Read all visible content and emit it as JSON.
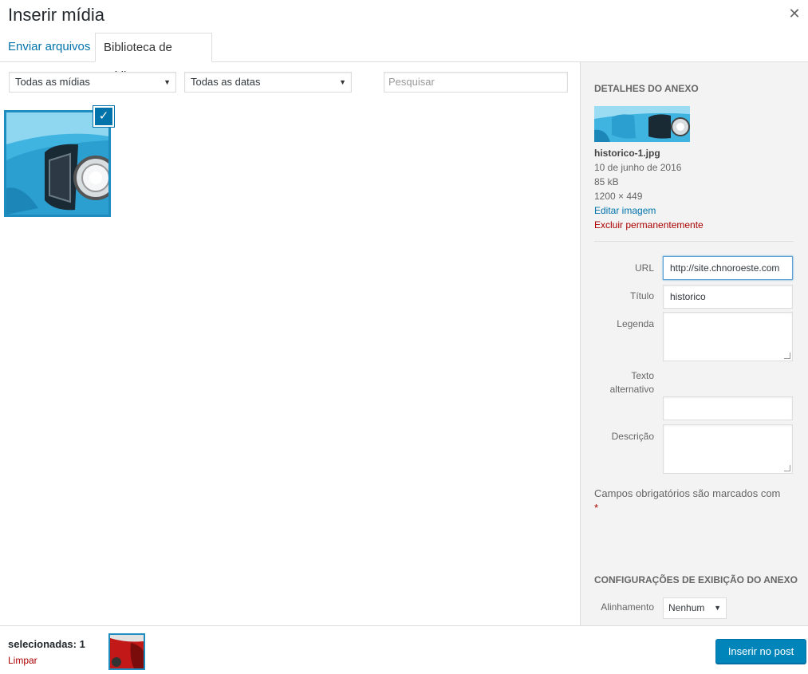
{
  "modal": {
    "title": "Inserir mídia",
    "close_icon": "close-icon"
  },
  "tabs": [
    {
      "label": "Enviar arquivos"
    },
    {
      "label": "Biblioteca de mídia",
      "active": true
    }
  ],
  "toolbar": {
    "media_filter": "Todas as mídias",
    "date_filter": "Todas as datas",
    "search_placeholder": "Pesquisar"
  },
  "attachment": {
    "selected": true
  },
  "details": {
    "heading": "Detalhes do anexo",
    "filename": "historico-1.jpg",
    "date": "10 de junho de 2016",
    "size": "85 kB",
    "dimensions": "1200 × 449",
    "edit_link": "Editar imagem",
    "delete_link": "Excluir permanentemente",
    "fields": {
      "url_label": "URL",
      "url_value": "http://site.chnoroeste.com",
      "title_label": "Título",
      "title_value": "historico",
      "caption_label": "Legenda",
      "alt_label_1": "Texto",
      "alt_label_2": "alternativo",
      "description_label": "Descrição"
    },
    "required_note": "Campos obrigatórios são marcados com",
    "required_star": "*"
  },
  "display": {
    "heading": "Configurações de exibição do anexo",
    "align_label": "Alinhamento",
    "align_value": "Nenhum"
  },
  "footer": {
    "selected_count": "selecionadas: 1",
    "clear_label": "Limpar",
    "insert_button": "Inserir no post"
  },
  "colors": {
    "accent": "#0073aa",
    "danger": "#a00",
    "button": "#0085ba"
  }
}
